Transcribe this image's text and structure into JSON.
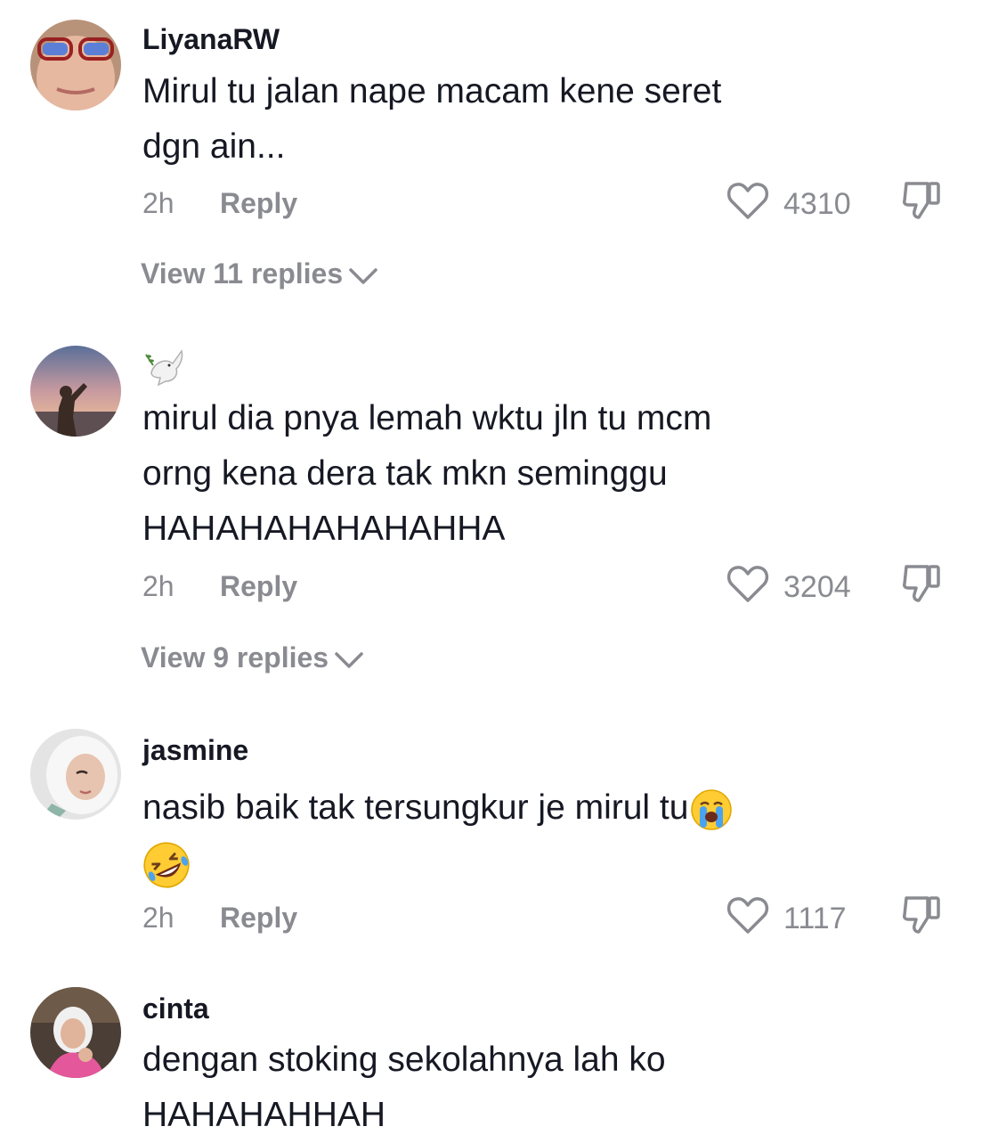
{
  "comments": [
    {
      "username": "LiyanaRW",
      "text_lines": [
        "Mirul tu jalan nape macam kene seret",
        "dgn ain..."
      ],
      "time": "2h",
      "reply_label": "Reply",
      "likes": "4310",
      "view_replies": "View 11 replies"
    },
    {
      "username": "🕊️",
      "text_lines": [
        "mirul dia pnya lemah wktu jln tu mcm",
        "orng kena dera tak mkn seminggu",
        "HAHAHAHAHAHAHHA"
      ],
      "time": "2h",
      "reply_label": "Reply",
      "likes": "3204",
      "view_replies": "View 9 replies"
    },
    {
      "username": "jasmine",
      "text_lines": [
        "nasib baik tak tersungkur je mirul tu",
        ""
      ],
      "time": "2h",
      "reply_label": "Reply",
      "likes": "1117"
    },
    {
      "username": "cinta",
      "text_lines": [
        "dengan stoking sekolahnya lah ko",
        "HAHAHAHHAH"
      ]
    }
  ],
  "colors": {
    "primary_text": "#161823",
    "secondary_text": "#8a8b91"
  },
  "icons": {
    "like": "heart-outline-icon",
    "dislike": "thumbs-down-outline-icon",
    "expand": "chevron-down-icon"
  }
}
